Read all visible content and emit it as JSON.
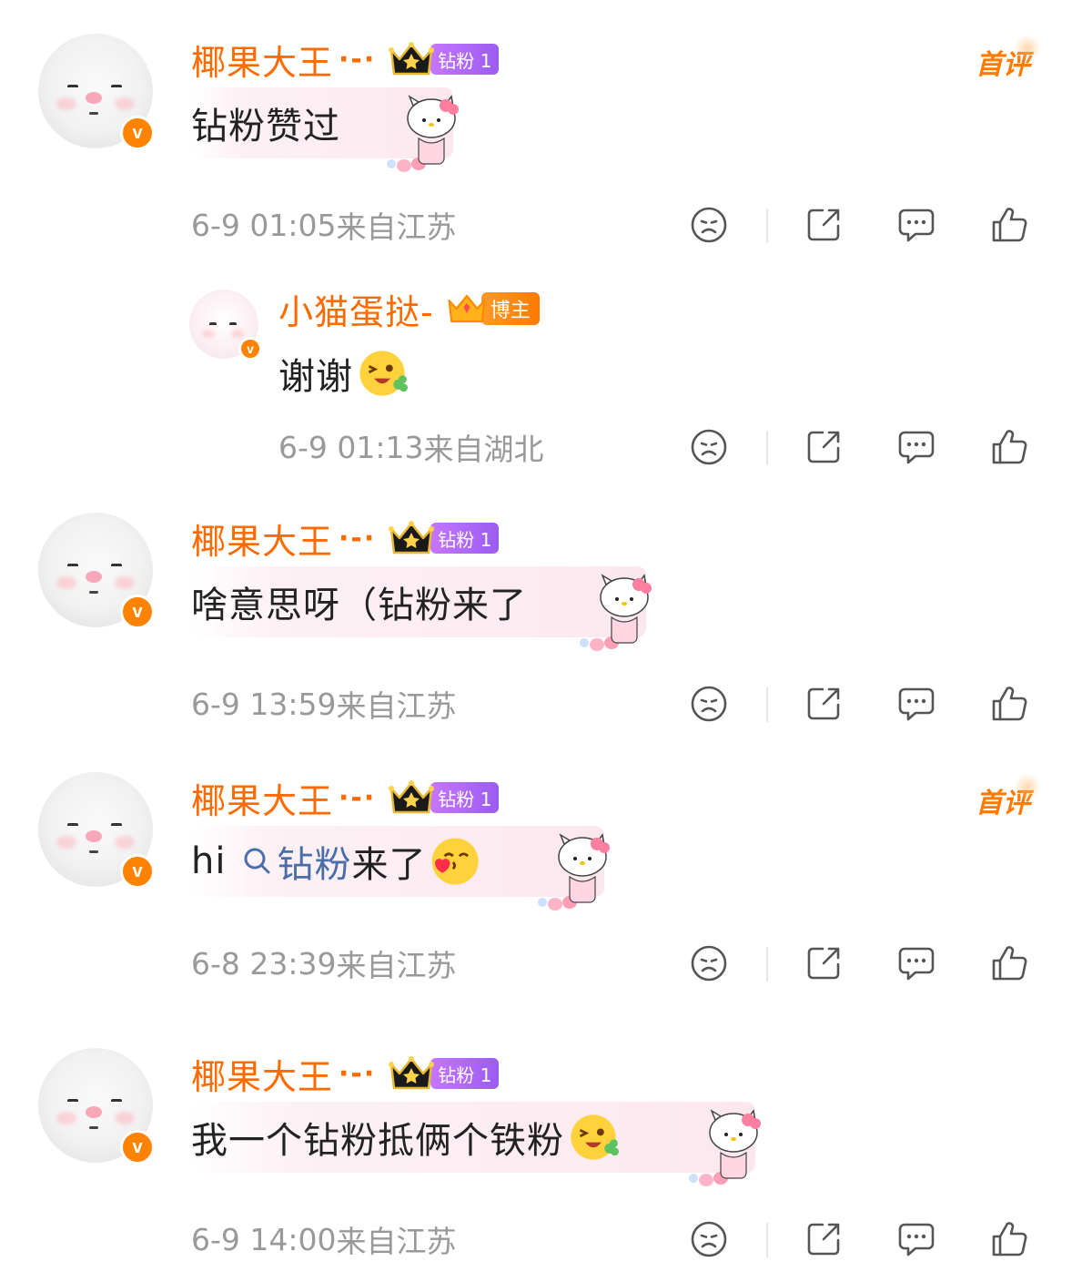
{
  "comments": [
    {
      "username": "椰果大王",
      "username_suffix": "·-·",
      "badge": "钻粉 1",
      "first_tag": "首评",
      "content": "钻粉赞过",
      "time": "6-9 01:05",
      "location": "来自江苏",
      "replies": [
        {
          "username": "小猫蛋挞-",
          "badge": "博主",
          "content": "谢谢",
          "time": "6-9 01:13",
          "location": "来自湖北"
        }
      ]
    },
    {
      "username": "椰果大王",
      "username_suffix": "·-·",
      "badge": "钻粉 1",
      "content": "啥意思呀（钻粉来了",
      "time": "6-9 13:59",
      "location": "来自江苏"
    },
    {
      "username": "椰果大王",
      "username_suffix": "·-·",
      "badge": "钻粉 1",
      "first_tag": "首评",
      "content_prefix": "hi",
      "content_link": "钻粉",
      "content_suffix": "来了",
      "time": "6-8 23:39",
      "location": "来自江苏"
    },
    {
      "username": "椰果大王",
      "username_suffix": "·-·",
      "badge": "钻粉 1",
      "content": "我一个钻粉抵俩个铁粉",
      "time": "6-9 14:00",
      "location": "来自江苏"
    }
  ],
  "icons": [
    "sad-face-icon",
    "share-icon",
    "comment-icon",
    "thumbs-up-icon",
    "crown-icon",
    "verified-v-icon",
    "search-icon"
  ],
  "colors": {
    "username": "#ff6a00",
    "verified": "#ff8200",
    "meta": "#999999",
    "badge_purple": "#a865f5",
    "badge_orange": "#ff8a14",
    "link": "#4a6ea8"
  }
}
